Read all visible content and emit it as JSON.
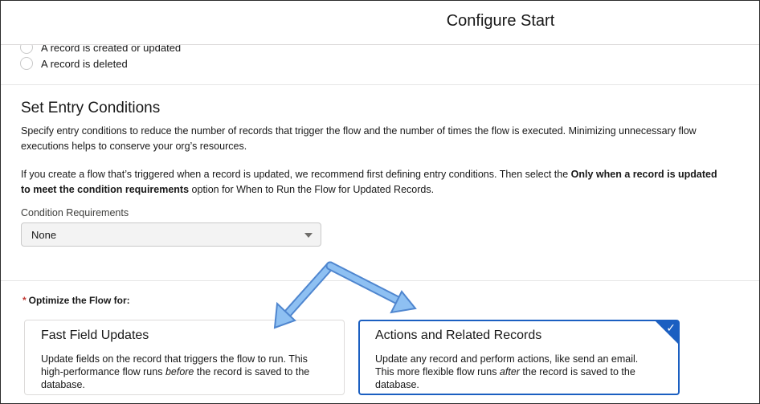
{
  "header": {
    "title": "Configure Start"
  },
  "trigger": {
    "options": [
      {
        "label": "A record is created or updated"
      },
      {
        "label": "A record is deleted"
      }
    ]
  },
  "entry_conditions": {
    "title": "Set Entry Conditions",
    "para1": "Specify entry conditions to reduce the number of records that trigger the flow and the number of times the flow is executed. Minimizing unnecessary flow executions helps to conserve your org’s resources.",
    "para2_before": "If you create a flow that’s triggered when a record is updated, we recommend first defining entry conditions. Then select the ",
    "para2_bold": "Only when a record is updated to meet the condition requirements",
    "para2_after": " option for When to Run the Flow for Updated Records.",
    "condition_label": "Condition Requirements",
    "condition_value": "None"
  },
  "optimize": {
    "required_marker": "*",
    "label": "Optimize the Flow for:",
    "cards": [
      {
        "title": "Fast Field Updates",
        "desc_before": "Update fields on the record that triggers the flow to run. This high-performance flow runs ",
        "desc_emph": "before",
        "desc_after": " the record is saved to the database.",
        "selected": false
      },
      {
        "title": "Actions and Related Records",
        "desc_before": "Update any record and perform actions, like send an email. This more flexible flow runs ",
        "desc_emph": "after",
        "desc_after": " the record is saved to the database.",
        "selected": true
      }
    ]
  },
  "colors": {
    "selected_border": "#1b5fc1",
    "annotation_arrow": "#6fa8e6",
    "required_star": "#c23934"
  },
  "icons": {
    "check": "✓"
  }
}
